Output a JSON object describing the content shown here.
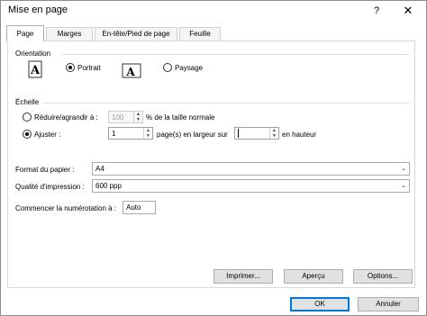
{
  "dialog": {
    "title": "Mise en page",
    "help_label": "?",
    "close_label": "✕"
  },
  "tabs": [
    {
      "label": "Page",
      "active": true
    },
    {
      "label": "Marges",
      "active": false
    },
    {
      "label": "En-tête/Pied de page",
      "active": false
    },
    {
      "label": "Feuille",
      "active": false
    }
  ],
  "orientation": {
    "section_label": "Orientation",
    "portrait_label": "Portrait",
    "landscape_label": "Paysage",
    "selected": "portrait",
    "icon_glyph": "A"
  },
  "scaling": {
    "section_label": "Échelle",
    "adjust_label": "Réduire/agrandir à :",
    "adjust_value": "100",
    "adjust_suffix": "% de la taille normale",
    "fit_label": "Ajuster :",
    "fit_width_value": "1",
    "fit_width_suffix": "page(s) en largeur sur",
    "fit_height_value": "",
    "fit_height_suffix": "en hauteur",
    "selected": "fit"
  },
  "paper": {
    "size_label": "Format du papier :",
    "size_value": "A4",
    "quality_label": "Qualité d'impression :",
    "quality_value": "600 ppp",
    "first_page_label": "Commencer la numérotation à :",
    "first_page_value": "Auto"
  },
  "buttons": {
    "print": "Imprimer...",
    "preview": "Aperçu",
    "options": "Options...",
    "ok": "OK",
    "cancel": "Annuler"
  },
  "colors": {
    "default_button_border": "#0078d7",
    "button_face": "#e1e1e1"
  }
}
